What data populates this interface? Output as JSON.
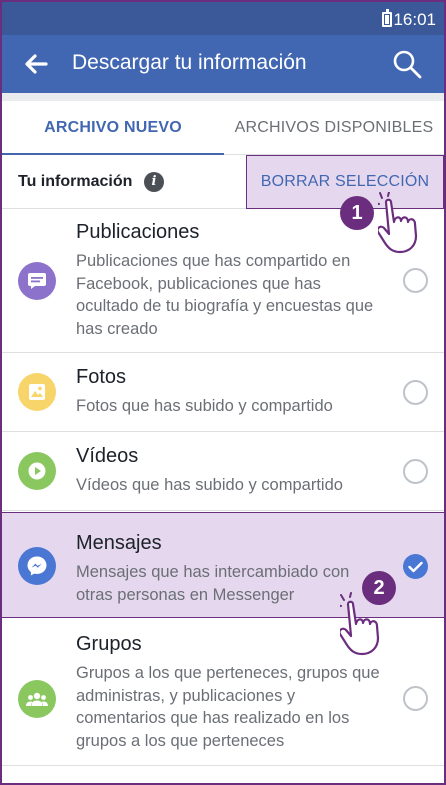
{
  "status_bar": {
    "time": "16:01"
  },
  "app_bar": {
    "title": "Descargar tu información",
    "back_icon": "arrow-left-icon",
    "search_icon": "search-icon"
  },
  "tabs": [
    {
      "label": "ARCHIVO NUEVO",
      "active": true
    },
    {
      "label": "ARCHIVOS DISPONIBLES",
      "active": false
    }
  ],
  "info_row": {
    "label": "Tu información",
    "clear_button": "BORRAR SELECCIÓN"
  },
  "items": [
    {
      "title": "Publicaciones",
      "desc": "Publicaciones que has compartido en Facebook, publicaciones que has ocultado de tu biografía y encuestas que has creado",
      "icon": "posts-icon",
      "color": "#8c72cb",
      "checked": false
    },
    {
      "title": "Fotos",
      "desc": "Fotos que has subido y compartido",
      "icon": "photos-icon",
      "color": "#f7d56b",
      "checked": false
    },
    {
      "title": "Vídeos",
      "desc": "Vídeos que has subido y compartido",
      "icon": "videos-icon",
      "color": "#8ac75f",
      "checked": false
    },
    {
      "title": "Mensajes",
      "desc": "Mensajes que has intercambiado con otras personas en Messenger",
      "icon": "messenger-icon",
      "color": "#4a76d4",
      "checked": true
    },
    {
      "title": "Grupos",
      "desc": "Grupos a los que perteneces, grupos que administras, y publicaciones y comentarios que has realizado en los grupos a los que perteneces",
      "icon": "groups-icon",
      "color": "#8ac75f",
      "checked": false
    }
  ],
  "annotations": [
    {
      "number": "1"
    },
    {
      "number": "2"
    }
  ],
  "colors": {
    "appbar": "#4267b2",
    "statusbar": "#3b5998",
    "highlight": "#e5d8ee",
    "annotation": "#6b2e7e"
  }
}
